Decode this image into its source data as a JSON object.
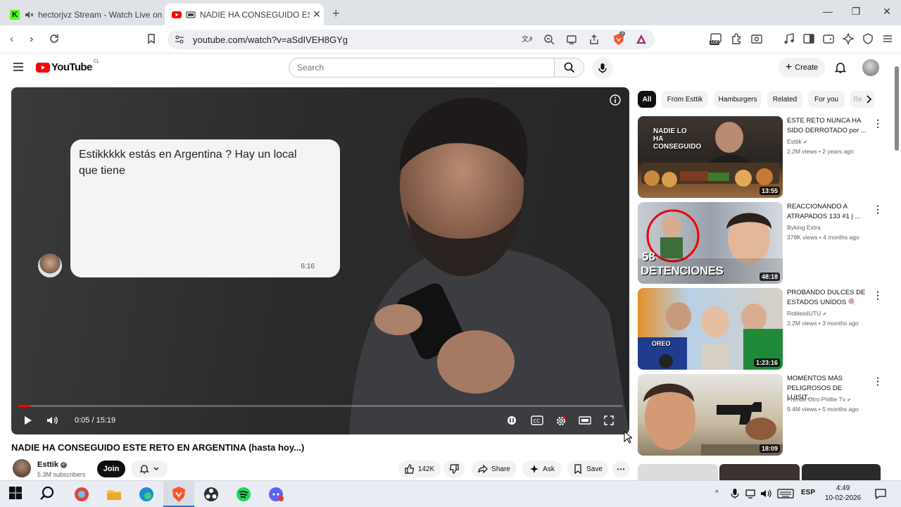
{
  "browser": {
    "tabs": [
      {
        "title": "hectorjvz Stream - Watch Live on",
        "active": false
      },
      {
        "title": "NADIE HA CONSEGUIDO ESTE",
        "active": true
      }
    ],
    "new_tab": "+",
    "url": "youtube.com/watch?v=aSdIVEH8GYg",
    "shield_count": "3",
    "ext_badge": "100"
  },
  "youtube": {
    "logo_text": "YouTube",
    "logo_region": "CL",
    "search_placeholder": "Search",
    "create_label": "Create"
  },
  "video": {
    "overlay_message": "Estikkkkk estás en Argentina ? Hay un local que tiene",
    "overlay_time": "6:16",
    "time_display": "0:05 / 15:19",
    "progress_fraction": 0.005,
    "title": "NADIE HA CONSEGUIDO ESTE RETO EN ARGENTINA (hasta hoy...)",
    "channel": "Esttik",
    "subscribers": "5.3M subscribers",
    "join_label": "Join",
    "likes": "142K",
    "share_label": "Share",
    "ask_label": "Ask",
    "save_label": "Save"
  },
  "sidebar": {
    "chips": [
      "All",
      "From Esttik",
      "Hamburgers",
      "Related",
      "For you",
      "Re"
    ],
    "items": [
      {
        "title": "ESTE RETO NUNCA HA SIDO DERROTADO por ...",
        "channel": "Esttik",
        "meta": "2.2M views • 2 years ago",
        "duration": "13:55",
        "thumb_text": "NADIE LO HA CONSEGUIDO"
      },
      {
        "title": "REACCIONANDO A ATRAPADOS 133 #1 | ...",
        "channel": "Byking Extra",
        "meta": "378K views • 4 months ago",
        "duration": "48:18",
        "thumb_text_a": "58",
        "thumb_text_b": "DETENCIONES"
      },
      {
        "title": "PROBANDO DULCES DE ESTADOS UNIDOS 🍭",
        "channel": "RobleisIUTU",
        "meta": "3.2M views • 3 months ago",
        "duration": "1:23:16",
        "thumb_text": "OREO"
      },
      {
        "title": "MOMENTOS MÁS PELIGROSOS DE LUISIT...",
        "channel": "Prende Otro Phillie Tv",
        "meta": "9.4M views • 5 months ago",
        "duration": "18:09"
      }
    ]
  },
  "taskbar": {
    "language": "ESP",
    "time": "4:49",
    "date": "10-02-2026"
  },
  "colors": {
    "youtube_red": "#ff0000",
    "brave_orange": "#fb542b"
  }
}
